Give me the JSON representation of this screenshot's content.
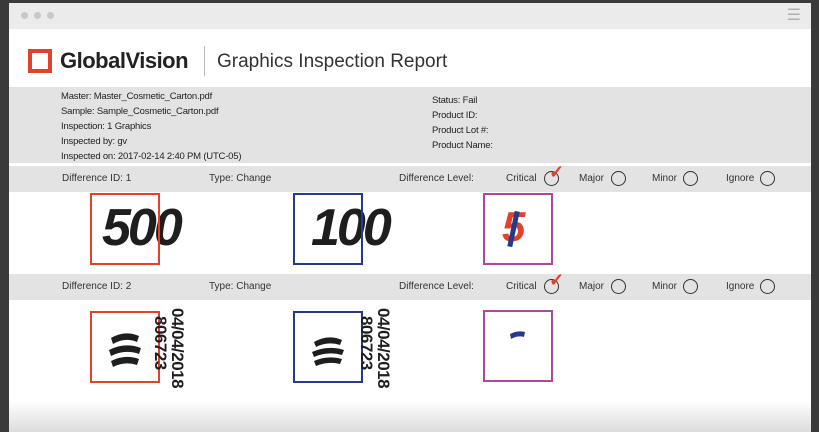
{
  "window": {
    "menu_icon": "hamburger-menu-icon"
  },
  "header": {
    "brand": "GlobalVision",
    "title": "Graphics Inspection Report",
    "accent": "#e2412a"
  },
  "info": {
    "left": [
      "Master: Master_Cosmetic_Carton.pdf",
      "Sample: Sample_Cosmetic_Carton.pdf",
      "Inspection: 1 Graphics",
      "Inspected by: gv",
      "Inspected on: 2017-02-14 2:40 PM (UTC-05)"
    ],
    "right": [
      "Status: Fail",
      "Product ID:",
      "Product Lot #:",
      "Product Name:"
    ]
  },
  "levels": [
    "Critical",
    "Major",
    "Minor",
    "Ignore"
  ],
  "differences": [
    {
      "id_label": "Difference ID: 1",
      "type_label": "Type: Change",
      "level_label": "Difference Level:",
      "selected_level": "Critical",
      "master_text": "500",
      "sample_text": "100",
      "diff_text": "5"
    },
    {
      "id_label": "Difference ID: 2",
      "type_label": "Type: Change",
      "level_label": "Difference Level:",
      "selected_level": "Critical",
      "master_date": "04/04/2018",
      "master_code": "806723",
      "sample_date": "04/04/2018",
      "sample_code": "806723"
    }
  ],
  "colors": {
    "master_frame": "#e2412a",
    "sample_frame": "#263a8c",
    "diff_frame": "#b0479e"
  }
}
